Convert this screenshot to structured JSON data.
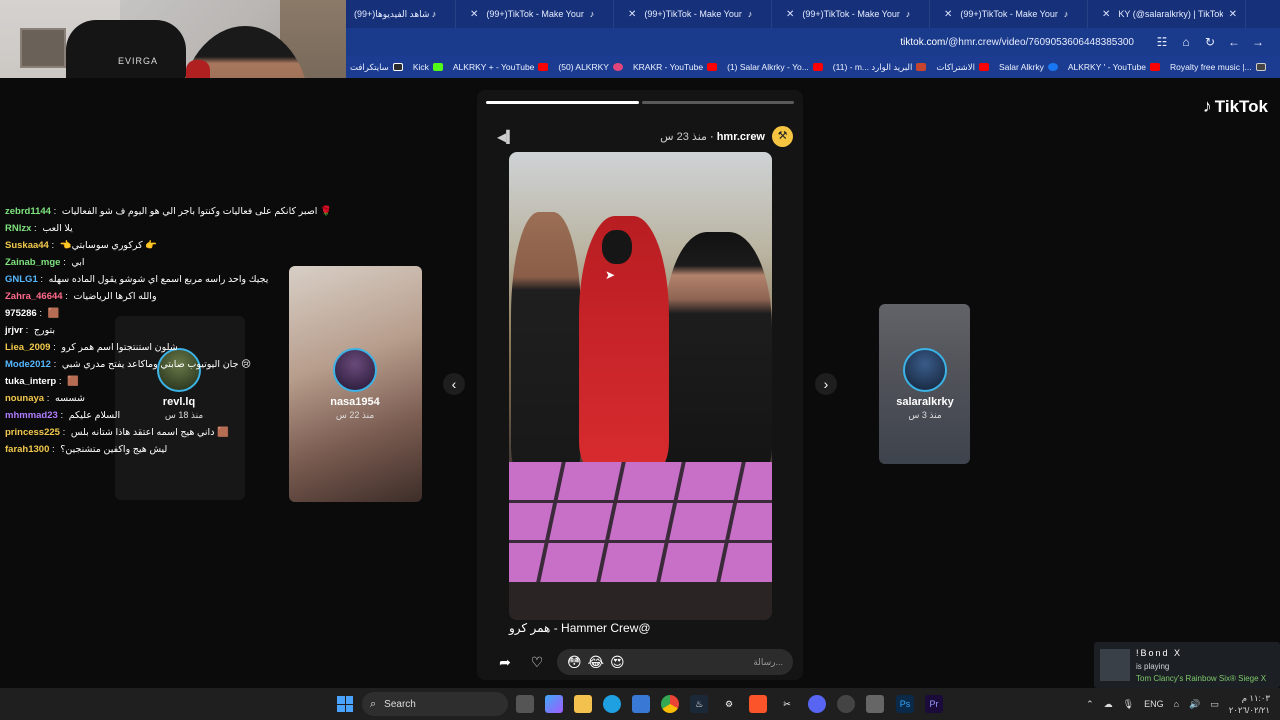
{
  "tabs": [
    {
      "title": "(99+)تابعه - شاهد الفيديوها",
      "close": "✕"
    },
    {
      "title": "(99+)TikTok - Make Your Day",
      "close": "✕"
    },
    {
      "title": "(99+)TikTok - Make Your Day",
      "close": "✕"
    },
    {
      "title": "(99+)TikTok - Make Your Day",
      "close": "✕"
    },
    {
      "title": "(99+)TikTok - Make Your Day",
      "close": "✕"
    },
    {
      "title": "KY (@salaralkrky) | TikTok(+99)",
      "close": "✕"
    }
  ],
  "address": {
    "domain": "tiktok.com",
    "path": "/@hmr.crew/video/7609053606448385300"
  },
  "bookmarks": [
    {
      "label": "سايتكرافت",
      "color": "#2b2b2b"
    },
    {
      "label": "Kick",
      "color": "#53fc18"
    },
    {
      "label": "ALKRKY + - YouTube",
      "color": "#ff0000"
    },
    {
      "label": "(50) ALKRKY",
      "color": "#e0457b"
    },
    {
      "label": "KRAKR - YouTube",
      "color": "#ff0000"
    },
    {
      "label": "(1) Salar Alkrky - Yo...",
      "color": "#ff0000"
    },
    {
      "label": "(11) - m... البريد الوارد",
      "color": "#c7442f"
    },
    {
      "label": "الاشتراكات",
      "color": "#ff0000"
    },
    {
      "label": "Salar Alkrky",
      "color": "#1877f2"
    },
    {
      "label": "ALKRKY ' - YouTube",
      "color": "#ff0000"
    },
    {
      "label": "Royalty free music |...",
      "color": "#444"
    }
  ],
  "logo": {
    "text": "TikTok"
  },
  "story": {
    "user": "hmr.crew",
    "time": "منذ 23 س",
    "caption": "همر كرو - Hammer Crew@",
    "message_placeholder": "رسالة...",
    "progress": [
      1.0,
      0.0
    ],
    "emojis": [
      "😳",
      "😂",
      "😍"
    ]
  },
  "side_stories": [
    {
      "user": "nasa1954",
      "time": "منذ 22 س"
    },
    {
      "user": "revl.lq",
      "time": "منذ 18 س"
    },
    {
      "user": "salaralkrky",
      "time": "منذ 3 س"
    }
  ],
  "webcam": {
    "chair_brand": "EVIRGA"
  },
  "chat": [
    {
      "user": "zebrd1144",
      "color": "#7ee37e",
      "msg": "اصبر كانكم على فعاليات وكنتوا باجر الي هو اليوم ف شو الفعاليات 🌹"
    },
    {
      "user": "RNlzx",
      "color": "#7ee37e",
      "msg": "يلا العب"
    },
    {
      "user": "Suskaa44",
      "color": "#f2c94c",
      "msg": "👈كركوري سوسابتي 👉"
    },
    {
      "user": "Zainab_mge",
      "color": "#7ee37e",
      "msg": "ابي"
    },
    {
      "user": "GNLG1",
      "color": "#56b8ff",
      "msg": "يجيك واحد راسه مربع اسمع اي شوشو يقول الماده سهله"
    },
    {
      "user": "Zahra_46644",
      "color": "#ff6a8a",
      "msg": "والله اكرها الرياضيات"
    },
    {
      "user": "975286",
      "color": "#fff",
      "msg": "🟫"
    },
    {
      "user": "jrjvr",
      "color": "#fff",
      "msg": "بتورج"
    },
    {
      "user": "Liea_2009",
      "color": "#f2c94c",
      "msg": "شلون استنتجتوا اسم همر كرو"
    },
    {
      "user": "Mode2012",
      "color": "#56b8ff",
      "msg": "جان اليوتيوب صابتي وماكاعد يفتح مدري شبي 😢"
    },
    {
      "user": "tuka_interp",
      "color": "#fff",
      "msg": "🟫"
    },
    {
      "user": "nounaya",
      "color": "#f2c94c",
      "msg": "شسسه"
    },
    {
      "user": "mhmmad23",
      "color": "#b07cff",
      "msg": "السلام عليكم"
    },
    {
      "user": "princess225",
      "color": "#f2c94c",
      "msg": "داني هيج اسمه اعتقد هاذا شتانه بلس 🟫"
    },
    {
      "user": "farah1300",
      "color": "#f2c94c",
      "msg": "ليش هيج واكفين متشنجين؟"
    }
  ],
  "notification": {
    "user": "!Bond X",
    "status": "is playing",
    "game": "Tom Clancy's Rainbow Six® Siege X"
  },
  "taskbar": {
    "search_label": "Search",
    "lang": "ENG",
    "time": "١١:٠٣ م",
    "date": "٢٠٢٦/٠٢/٢١"
  }
}
